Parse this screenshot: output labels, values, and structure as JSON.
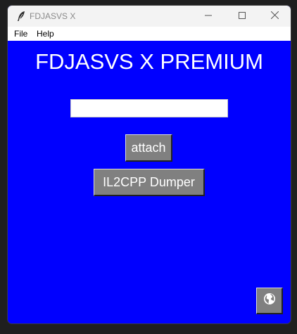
{
  "window": {
    "title": "FDJASVS X",
    "icon": "feather-icon",
    "controls": [
      "minimize-icon",
      "maximize-icon",
      "close-icon"
    ]
  },
  "menu": {
    "items": [
      {
        "label": "File"
      },
      {
        "label": "Help"
      }
    ]
  },
  "main": {
    "heading": "FDJASVS X PREMIUM",
    "input": {
      "value": "",
      "placeholder": ""
    },
    "attach_label": "attach",
    "dumper_label": "IL2CPP Dumper",
    "globe_icon": "globe-icon"
  },
  "colors": {
    "background": "#0000ff",
    "button": "#808080",
    "text": "#ffffff"
  }
}
